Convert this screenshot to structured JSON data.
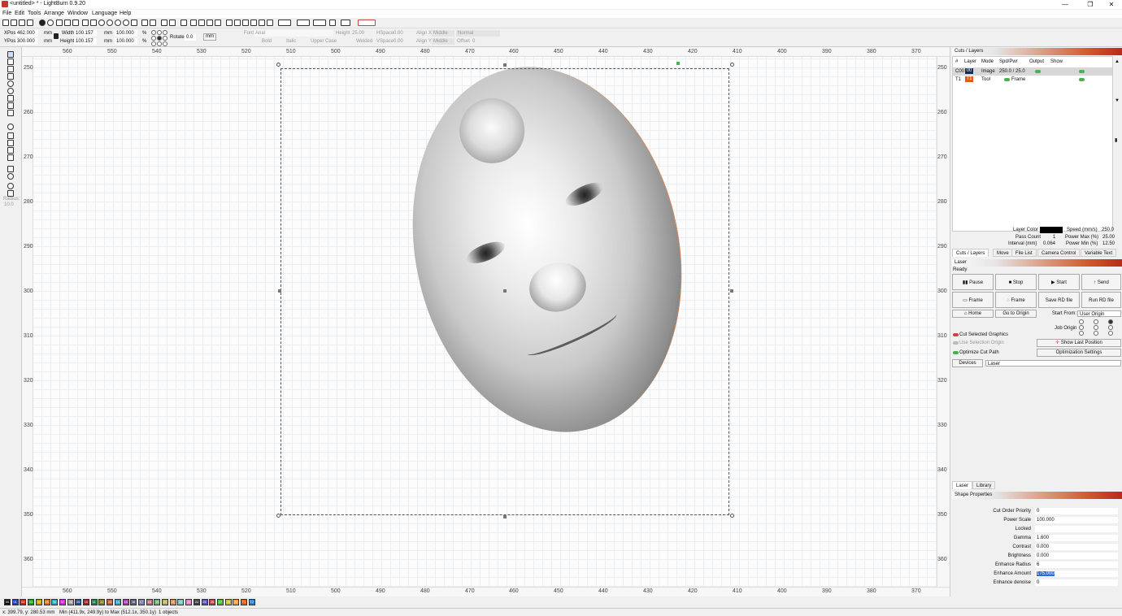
{
  "window": {
    "title": "<untitled> * - LightBurn 0.9.20",
    "min": "—",
    "max": "❐",
    "close": "✕"
  },
  "menu": [
    "File",
    "Edit",
    "Tools",
    "Arrange",
    "Window",
    "Language",
    "Help"
  ],
  "toolbar2": {
    "xpos_label": "XPos",
    "xpos_value": "462.000",
    "ypos_label": "YPos",
    "ypos_value": "300.000",
    "unit": "mm",
    "width_label": "Width",
    "width_value": "100.157",
    "height_label": "Height",
    "height_value": "100.157",
    "wpct": "100.000",
    "hpct": "100.000",
    "pct": "%",
    "rotate_label": "Rotate",
    "rotate_value": "0.0",
    "mm_button": "mm",
    "font_label": "Font",
    "font_value": "Arial",
    "text_height_label": "Height",
    "text_height_value": "25.00",
    "hspace_label": "HSpace",
    "hspace_value": "0.00",
    "vspace_label": "VSpace",
    "vspace_value": "0.00",
    "alignx_label": "Align X",
    "alignx_value": "Middle",
    "aligny_label": "Align Y",
    "aligny_value": "Middle",
    "normal_value": "Normal",
    "offset_label": "Offset",
    "offset_value": "0",
    "bold": "Bold",
    "italic": "Italic",
    "uppercase": "Upper Case",
    "welded": "Welded"
  },
  "lefttools": {
    "radius_label": "Radius:",
    "radius_value": "10.0"
  },
  "ruler": {
    "x_top": [
      "560",
      "550",
      "540",
      "530",
      "520",
      "510",
      "500",
      "490",
      "480",
      "470",
      "460",
      "450",
      "440",
      "430",
      "420",
      "410",
      "400",
      "390",
      "380",
      "370"
    ],
    "x_bot": [
      "560",
      "550",
      "540",
      "530",
      "520",
      "510",
      "500",
      "490",
      "480",
      "470",
      "460",
      "450",
      "440",
      "430",
      "420",
      "410",
      "400",
      "390",
      "380",
      "370"
    ],
    "y_left": [
      "250",
      "260",
      "270",
      "280",
      "290",
      "300",
      "310",
      "320",
      "330",
      "340",
      "350",
      "360"
    ],
    "y_right": [
      "250",
      "260",
      "270",
      "280",
      "290",
      "300",
      "310",
      "320",
      "330",
      "340",
      "350",
      "360"
    ]
  },
  "cuts": {
    "title": "Cuts / Layers",
    "headers": [
      "#",
      "Layer",
      "Mode",
      "Spd/Pwr",
      "Output",
      "Show"
    ],
    "rows": [
      {
        "num": "C00",
        "swatch": "00",
        "mode": "Image",
        "spdpwr": "250.0 / 25.0",
        "color": "#1f2b57"
      },
      {
        "num": "T1",
        "swatch": "T1",
        "mode": "Tool",
        "spdpwr": "Frame",
        "color": "#e05a1a"
      }
    ],
    "layer_color_label": "Layer Color",
    "pass_count_label": "Pass Count",
    "pass_count_value": "1",
    "interval_label": "Interval (mm)",
    "interval_value": "0.064",
    "speed_label": "Speed (mm/s)",
    "speed_value": "250.0",
    "power_max_label": "Power Max (%)",
    "power_max_value": "25.00",
    "power_min_label": "Power Min (%)",
    "power_min_value": "12.50"
  },
  "tabs1": [
    "Cuts / Layers",
    "Move",
    "File List",
    "Camera Control",
    "Variable Text"
  ],
  "laser": {
    "title": "Laser",
    "status": "Ready",
    "pause": "Pause",
    "stop": "Stop",
    "start": "Start",
    "send": "Send",
    "frame1": "Frame",
    "frame2": "Frame",
    "save_rd": "Save RD file",
    "run_rd": "Run RD file",
    "home": "Home",
    "go_origin": "Go to Origin",
    "start_from_label": "Start From:",
    "start_from_value": "User Origin",
    "job_origin_label": "Job Origin",
    "cut_selected": "Cut Selected Graphics",
    "use_sel_origin": "Use Selection Origin",
    "optimize": "Optimize Cut Path",
    "show_last": "Show Last Position",
    "opt_settings": "Optimization Settings",
    "devices": "Devices",
    "device_value": "Laser"
  },
  "tabs2": [
    "Laser",
    "Library"
  ],
  "shape": {
    "title": "Shape Properties",
    "rows": [
      {
        "label": "Cut Order Priority",
        "value": "0"
      },
      {
        "label": "Power Scale",
        "value": "100.000"
      },
      {
        "label": "Locked",
        "value": ""
      },
      {
        "label": "Gamma",
        "value": "1.600"
      },
      {
        "label": "Contrast",
        "value": "0.000"
      },
      {
        "label": "Brightness",
        "value": "0.000"
      },
      {
        "label": "Enhance Radius",
        "value": "6"
      },
      {
        "label": "Enhance Amount",
        "value": "175.000"
      },
      {
        "label": "Enhance denoise",
        "value": "0"
      }
    ]
  },
  "palette": [
    {
      "l": "00",
      "c": "#111111"
    },
    {
      "l": "01",
      "c": "#1f3fbf"
    },
    {
      "l": "02",
      "c": "#d02020"
    },
    {
      "l": "03",
      "c": "#20a020"
    },
    {
      "l": "04",
      "c": "#c8a000"
    },
    {
      "l": "05",
      "c": "#e07020"
    },
    {
      "l": "06",
      "c": "#20b0c0"
    },
    {
      "l": "07",
      "c": "#e020e0"
    },
    {
      "l": "08",
      "c": "#a0a0a0"
    },
    {
      "l": "09",
      "c": "#2050a0"
    },
    {
      "l": "10",
      "c": "#a02020"
    },
    {
      "l": "11",
      "c": "#208050"
    },
    {
      "l": "12",
      "c": "#808020"
    },
    {
      "l": "13",
      "c": "#c06030"
    },
    {
      "l": "14",
      "c": "#40a0d0"
    },
    {
      "l": "15",
      "c": "#a040a0"
    },
    {
      "l": "16",
      "c": "#606080"
    },
    {
      "l": "17",
      "c": "#8080c0"
    },
    {
      "l": "18",
      "c": "#c07070"
    },
    {
      "l": "19",
      "c": "#70b070"
    },
    {
      "l": "20",
      "c": "#b0b060"
    },
    {
      "l": "21",
      "c": "#d09060"
    },
    {
      "l": "22",
      "c": "#80c0c0"
    },
    {
      "l": "23",
      "c": "#e080c0"
    },
    {
      "l": "24",
      "c": "#404040"
    },
    {
      "l": "25",
      "c": "#5050c0"
    },
    {
      "l": "26",
      "c": "#c04040"
    },
    {
      "l": "27",
      "c": "#40c040"
    },
    {
      "l": "28",
      "c": "#c0c040"
    },
    {
      "l": "29",
      "c": "#f0a040"
    },
    {
      "l": "T1",
      "c": "#e05a1a"
    },
    {
      "l": "T2",
      "c": "#2080e0"
    }
  ],
  "status": {
    "coords": "x: 399.79, y: 280.53 mm",
    "bounds": "Min (411.9x, 249.9y) to Max (512.1x, 350.1y)",
    "objects": "1 objects"
  }
}
